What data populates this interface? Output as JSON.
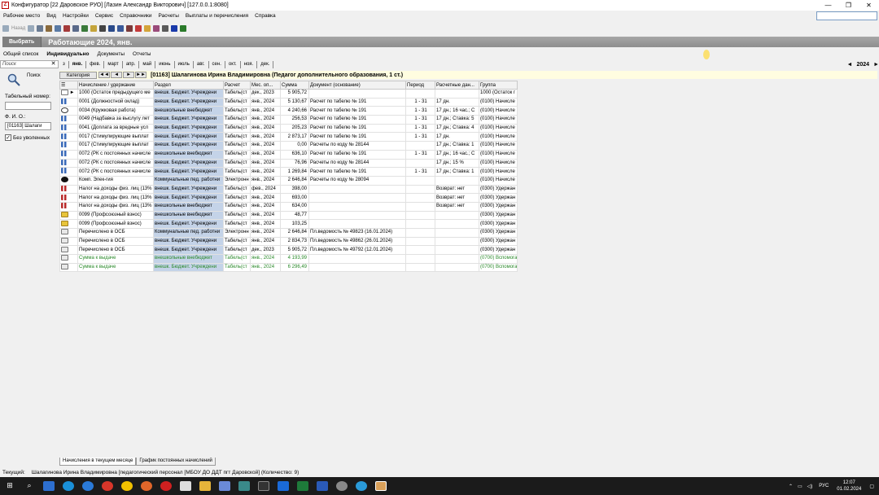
{
  "window": {
    "title": "Конфигуратор [22 Даровское РУО] [Лазин Александр Викторович] [127.0.0.1:8080]",
    "app_icon": "Z"
  },
  "menu": [
    "Рабочее место",
    "Вид",
    "Настройки",
    "Сервис",
    "Справочники",
    "Расчеты",
    "Выплаты и перечисления",
    "Справка"
  ],
  "toolbar": {
    "back_label": "Назад"
  },
  "header": {
    "select_label": "Выбрать",
    "title": "Работающие 2024, янв."
  },
  "mode_tabs": [
    "Общий список",
    "Индивидуально",
    "Документы",
    "Отчеты"
  ],
  "search": {
    "placeholder": "Поиск"
  },
  "left": {
    "search_label": "Поиск",
    "tabnum_label": "Табельный номер:",
    "fio_label": "Ф. И. О.:",
    "fio_value": "[01163] Шалаги",
    "dismissed_label": "Без уволенных"
  },
  "months": [
    "з",
    "янв.",
    "фев.",
    "март",
    "апр.",
    "май",
    "июнь",
    "июль",
    "авг.",
    "сен.",
    "окт.",
    "ноя.",
    "дек."
  ],
  "year": "2024",
  "category_label": "Категория",
  "employee": "[01163] Шалагинова Ирина Владимировна (Педагог дополнительного образования, 1 ст.)",
  "columns": [
    "Начисление / удержание",
    "Раздел",
    "Расчет",
    "Мес. оп...",
    "Сумма",
    "Документ (основание)",
    "Период",
    "Расчетные дан...",
    "Группа"
  ],
  "rows": [
    [
      "1000 (Остаток предыдущего ме",
      "внешк. Бюджет. Учреждени",
      "Табель(ст",
      "дек., 2023",
      "5 905,72",
      "",
      "",
      "",
      "1000 (Остаток г"
    ],
    [
      "0001 (Должностной оклад)",
      "внешк. Бюджет. Учреждени",
      "Табель(ст",
      "янв., 2024",
      "5 130,67",
      "Расчет по табелю № 191",
      "1 - 31",
      "17 дн.",
      "(0100) Начисле"
    ],
    [
      "0034 (Кружковая работа)",
      "внешкольные внебюджет",
      "Табель(ст",
      "янв., 2024",
      "4 240,66",
      "Расчет по табелю № 191",
      "1 - 31",
      "17 дн.; 16 час.; С",
      "(0100) Начисле"
    ],
    [
      "0049 (Надбавка за выслугу лет",
      "внешк. Бюджет. Учреждени",
      "Табель(ст",
      "янв., 2024",
      "256,53",
      "Расчет по табелю № 191",
      "1 - 31",
      "17 дн.; Ставка: 5",
      "(0100) Начисле"
    ],
    [
      "0041 (Доплата за вредные усл",
      "внешк. Бюджет. Учреждени",
      "Табель(ст",
      "янв., 2024",
      "205,23",
      "Расчет по табелю № 191",
      "1 - 31",
      "17 дн.; Ставка: 4",
      "(0100) Начисле"
    ],
    [
      "0017 (Стимулирующие выплат",
      "внешк. Бюджет. Учреждени",
      "Табель(ст",
      "янв., 2024",
      "2 873,17",
      "Расчет по табелю № 191",
      "1 - 31",
      "17 дн.",
      "(0100) Начисле"
    ],
    [
      "0017 (Стимулирующие выплат",
      "внешк. Бюджет. Учреждени",
      "Табель(ст",
      "янв., 2024",
      "0,00",
      "Расчеты по коду № 28144",
      "",
      "17 дн.; Ставка: 1",
      "(0100) Начисле"
    ],
    [
      "0072 (РК с постоянных начисле",
      "внешкольные внебюджет",
      "Табель(ст",
      "янв., 2024",
      "636,10",
      "Расчет по табелю № 191",
      "1 - 31",
      "17 дн.; 16 час.; С",
      "(0100) Начисле"
    ],
    [
      "0072 (РК с постоянных начисле",
      "внешк. Бюджет. Учреждени",
      "Табель(ст",
      "янв., 2024",
      "76,96",
      "Расчеты по коду № 28144",
      "",
      "17 дн.; 15 %",
      "(0100) Начисле"
    ],
    [
      "0072 (РК с постоянных начисле",
      "внешк. Бюджет. Учреждени",
      "Табель(ст",
      "янв., 2024",
      "1 269,84",
      "Расчет по табелю № 191",
      "1 - 31",
      "17 дн.; Ставка: 1",
      "(0100) Начисле"
    ],
    [
      "Комп. Элек-гия",
      "Коммунальные пед. работни",
      "Электронн",
      "янв., 2024",
      "2 646,84",
      "Расчеты по коду № 28094",
      "",
      "",
      "(0100) Начисле"
    ],
    [
      "Налог на доходы физ. лиц (13%",
      "внешк. Бюджет. Учреждени",
      "Табель(ст",
      "фев., 2024",
      "398,00",
      "",
      "",
      "Возврат: нет",
      "(0300) Удержан"
    ],
    [
      "Налог на доходы физ. лиц (13%",
      "внешк. Бюджет. Учреждени",
      "Табель(ст",
      "янв., 2024",
      "693,00",
      "",
      "",
      "Возврат: нет",
      "(0300) Удержан"
    ],
    [
      "Налог на доходы физ. лиц (13%",
      "внешкольные внебюджет",
      "Табель(ст",
      "янв., 2024",
      "634,00",
      "",
      "",
      "Возврат: нет",
      "(0300) Удержан"
    ],
    [
      "0099 (Профсоюзный взнос)",
      "внешкольные внебюджет",
      "Табель(ст",
      "янв., 2024",
      "48,77",
      "",
      "",
      "",
      "(0300) Удержан"
    ],
    [
      "0099 (Профсоюзный взнос)",
      "внешк. Бюджет. Учреждени",
      "Табель(ст",
      "янв., 2024",
      "103,25",
      "",
      "",
      "",
      "(0300) Удержан"
    ],
    [
      "Перечислено в ОСБ",
      "Коммунальные пед. работни",
      "Электронн",
      "янв., 2024",
      "2 646,84",
      "Пл.ведомость № 49823 (16.01.2024)",
      "",
      "",
      "(0300) Удержан"
    ],
    [
      "Перечислено в ОСБ",
      "внешк. Бюджет. Учреждени",
      "Табель(ст",
      "янв., 2024",
      "2 834,73",
      "Пл.ведомость № 49862 (26.01.2024)",
      "",
      "",
      "(0300) Удержан"
    ],
    [
      "Перечислено в ОСБ",
      "внешк. Бюджет. Учреждени",
      "Табель(ст",
      "дек., 2023",
      "5 905,72",
      "Пл.ведомость № 49792 (12.01.2024)",
      "",
      "",
      "(0300) Удержан"
    ],
    [
      "Сумма к выдаче",
      "внешкольные внебюджет",
      "Табель(ст",
      "янв., 2024",
      "4 193,99",
      "",
      "",
      "",
      "(0700) Вспомога"
    ],
    [
      "Сумма к выдаче",
      "внешк. Бюджет. Учреждени",
      "Табель(ст",
      "янв., 2024",
      "6 296,49",
      "",
      "",
      "",
      "(0700) Вспомога"
    ]
  ],
  "row_icons": [
    "arrow",
    "bars-blue",
    "clock",
    "bars-blue",
    "bars-blue",
    "bars-blue",
    "bars-blue",
    "bars-blue",
    "bars-blue",
    "bars-blue",
    "ball",
    "bars-red",
    "bars-red",
    "bars-red",
    "yellow",
    "yellow",
    "doc",
    "doc",
    "doc",
    "doc",
    "doc"
  ],
  "bottom_tabs": [
    "Начисления в текущем месяце",
    "График постоянных начислений"
  ],
  "status": {
    "label": "Текущий:",
    "text": "Шалагинова Ирина Владимировна [педагогический персонал [МБОУ ДО ДДТ пгт Даровской] (Количество: 9)"
  },
  "taskbar": {
    "lang": "РУС",
    "time": "12:07",
    "date": "01.02.2024"
  },
  "colors": {
    "band": "#8e8e8e",
    "selection": "#c4d3e8",
    "category_bar": "#fffde0",
    "green_text": "#2a8a2a"
  }
}
